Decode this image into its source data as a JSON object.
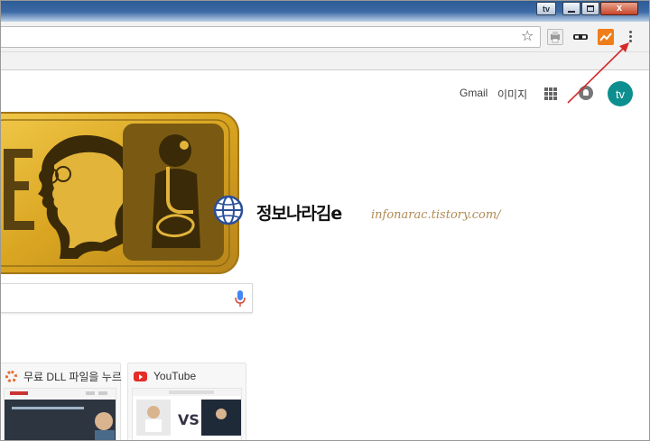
{
  "window": {
    "tv_label": "tv",
    "close_glyph": "x"
  },
  "toolbar": {
    "bookmark_star_icon": "star-icon",
    "menu_icon": "three-dots-vertical-icon"
  },
  "google_bar": {
    "gmail_label": "Gmail",
    "images_label": "이미지",
    "avatar_initials": "tv"
  },
  "watermark": {
    "name": "정보나라김e",
    "url": "infonarac.tistory.com/"
  },
  "tiles": [
    {
      "title": "무료 DLL 파일을 누르"
    },
    {
      "title": "YouTube"
    }
  ],
  "colors": {
    "avatar": "#0e8f8f",
    "annotation_arrow": "#d52a2a",
    "youtube_red": "#e52d27",
    "doodle_gold": "#d9a521"
  }
}
